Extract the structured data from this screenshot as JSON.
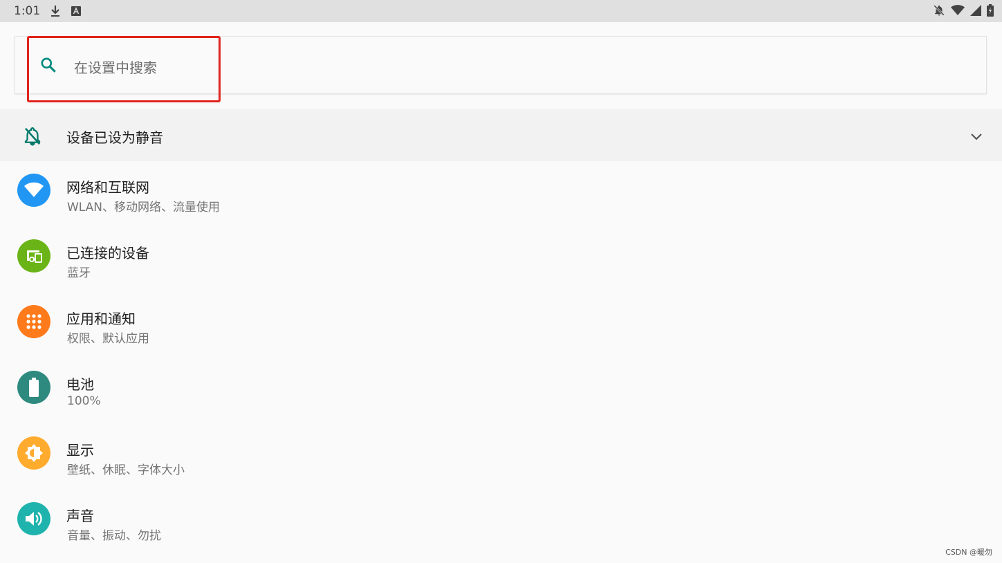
{
  "status_bar": {
    "time": "1:01",
    "left_icons": [
      "download-icon",
      "a-icon"
    ],
    "right_icons": [
      "bell-off-icon",
      "wifi-icon",
      "cell-signal-icon",
      "battery-charging-icon"
    ]
  },
  "search": {
    "placeholder": "在设置中搜索",
    "icon": "search-icon"
  },
  "condition": {
    "label": "设备已设为静音",
    "icon": "bell-off-icon",
    "expand_icon": "chevron-down-icon"
  },
  "items": [
    {
      "title": "网络和互联网",
      "summary": "WLAN、移动网络、流量使用",
      "icon": "wifi-icon",
      "color": "#2196f3"
    },
    {
      "title": "已连接的设备",
      "summary": "蓝牙",
      "icon": "devices-icon",
      "color": "#6ab417"
    },
    {
      "title": "应用和通知",
      "summary": "权限、默认应用",
      "icon": "apps-icon",
      "color": "#ff7a1a"
    },
    {
      "title": "电池",
      "summary": "100%",
      "icon": "battery-icon",
      "color": "#2e8a7e"
    },
    {
      "title": "显示",
      "summary": "壁纸、休眠、字体大小",
      "icon": "brightness-icon",
      "color": "#ffab2e"
    },
    {
      "title": "声音",
      "summary": "音量、振动、勿扰",
      "icon": "volume-icon",
      "color": "#1eb3ad"
    }
  ],
  "colors": {
    "accent": "#00897b",
    "highlight_box": "#e0241d",
    "status_bar_bg": "#e0e0e0"
  },
  "watermark": "CSDN @暖勿"
}
